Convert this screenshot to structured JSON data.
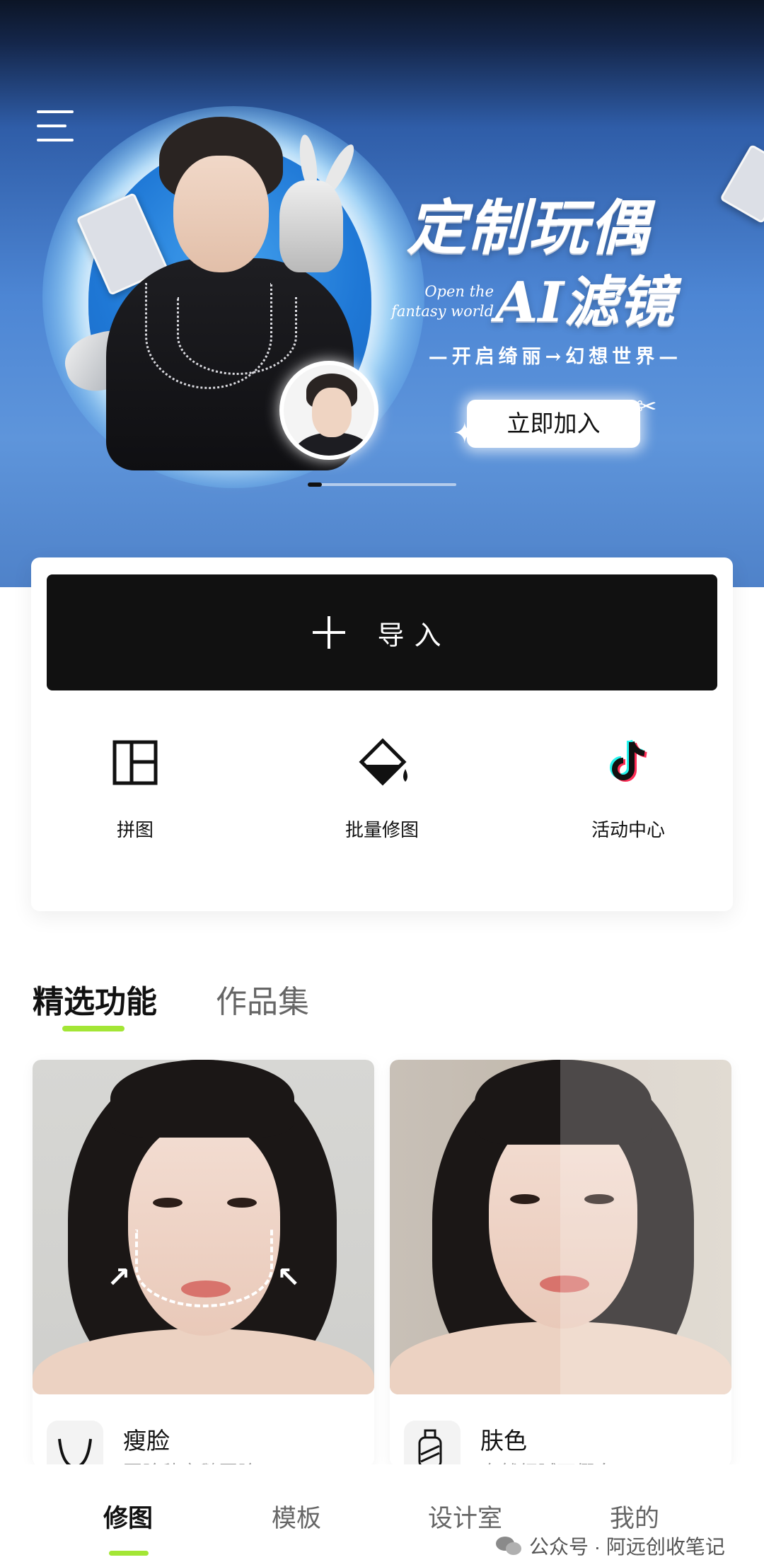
{
  "banner": {
    "title_line1": "定制玩偶",
    "title_line2": "AI滤镜",
    "english_line1": "Open the",
    "english_line2": "fantasy world",
    "subtitle": "—开启绮丽→幻想世界—",
    "cta_label": "立即加入",
    "slide_count": 1
  },
  "actions": {
    "import_label": "导入",
    "tools": [
      {
        "label": "拼图",
        "icon": "collage-icon"
      },
      {
        "label": "批量修图",
        "icon": "paint-bucket-icon"
      },
      {
        "label": "活动中心",
        "icon": "tiktok-icon"
      }
    ]
  },
  "tabs": [
    {
      "label": "精选功能",
      "active": true
    },
    {
      "label": "作品集",
      "active": false
    }
  ],
  "features": [
    {
      "title": "瘦脸",
      "desc": "圆脸秒变鹅蛋脸",
      "icon": "face-slim-icon"
    },
    {
      "title": "肤色",
      "desc": "自然细腻不假白",
      "icon": "skin-tone-icon"
    }
  ],
  "bottom_nav": [
    {
      "label": "修图",
      "active": true
    },
    {
      "label": "模板",
      "active": false
    },
    {
      "label": "设计室",
      "active": false
    },
    {
      "label": "我的",
      "active": false
    }
  ],
  "watermark": "公众号 · 阿远创收笔记",
  "colors": {
    "accent": "#a3e635",
    "import_button": "#111111",
    "banner_blue": "#4d86d4"
  }
}
